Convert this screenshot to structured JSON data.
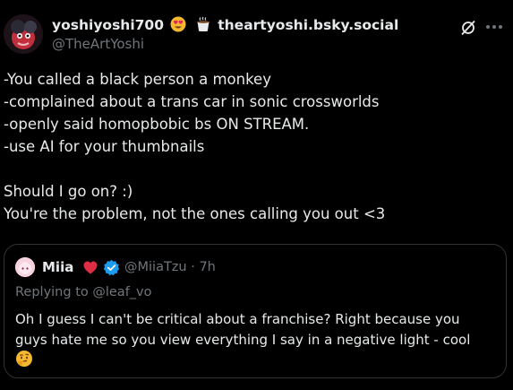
{
  "post": {
    "display_name": "yoshiyoshi700",
    "display_name_suffix": "theartyoshi.bsky.social",
    "handle": "@TheArtYoshi",
    "emojis": [
      "smiling-face-with-heart-eyes",
      "hot-beverage"
    ],
    "body": "-You called a black person a monkey\n-complained about a trans car in sonic crossworlds\n-openly said homopbobic bs ON STREAM.\n-use AI for your thumbnails\n\nShould I go on? :)\nYou're the problem, not the ones calling you out <3"
  },
  "quote": {
    "display_name": "Miia",
    "name_emoji": "red-heart",
    "verified": true,
    "handle": "@MiiaTzu",
    "separator": "·",
    "time": "7h",
    "replying_to": "Replying to @leaf_vo",
    "body": "Oh I guess I can't be critical about a franchise? Right because you\nguys hate me so you view everything I say in a negative light - cool",
    "trailing_emoji": "thinking-face"
  },
  "colors": {
    "background": "#000000",
    "text": "#e7e9ea",
    "secondary": "#71767b",
    "border": "#2f3336",
    "verified": "#1d9bf0",
    "heart": "#e0245e"
  },
  "icons": {
    "grok": "grok-icon",
    "more": "more-icon"
  }
}
